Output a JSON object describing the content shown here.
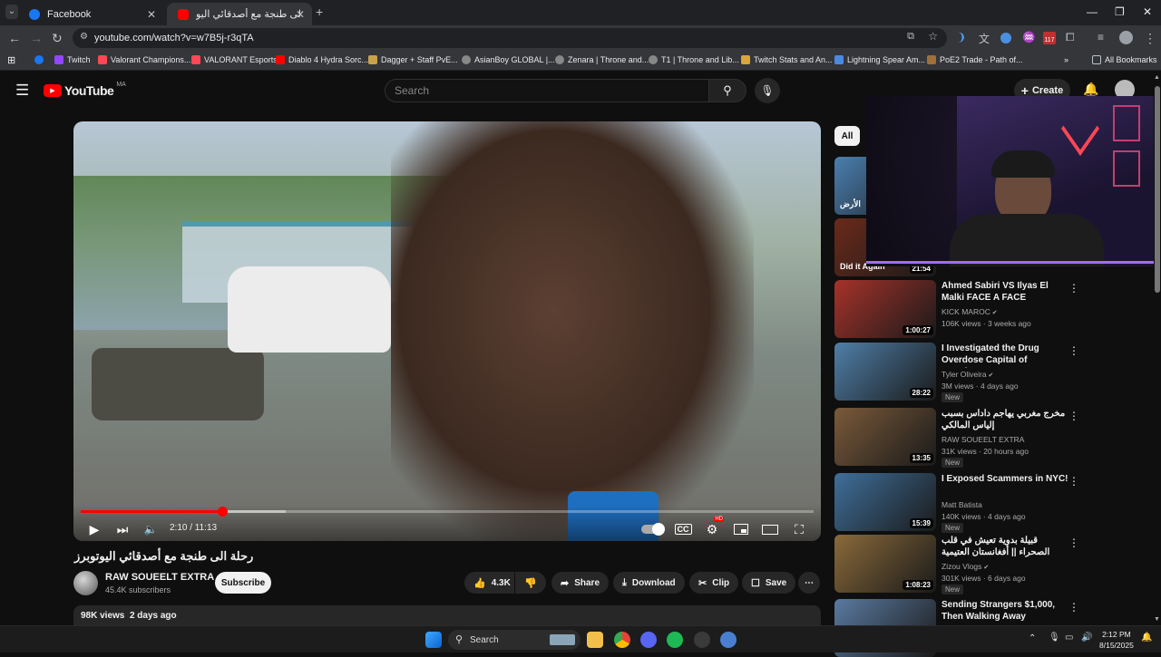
{
  "browser": {
    "tabs": [
      {
        "title": "Facebook",
        "active": false
      },
      {
        "title": "رحلة الى طنجة مع أصدقائي اليو",
        "active": true
      }
    ],
    "url": "youtube.com/watch?v=w7B5j-r3qTA",
    "bookmarks": [
      "Twitch",
      "Valorant Champions...",
      "VALORANT Esports",
      "Diablo 4 Hydra Sorc...",
      "Dagger + Staff PvE...",
      "AsianBoy GLOBAL |...",
      "Zenara | Throne and...",
      "T1 | Throne and Lib...",
      "Twitch Stats and An...",
      "Lightning Spear Am...",
      "PoE2 Trade - Path of..."
    ],
    "all_bookmarks": "All Bookmarks",
    "badge_count": "117"
  },
  "yt": {
    "logo": "YouTube",
    "country": "MA",
    "search_placeholder": "Search",
    "create_label": "Create"
  },
  "player": {
    "time": "2:10 / 11:13",
    "progress_fraction": 0.193,
    "buffer_fraction": 0.28,
    "hd_badge": "HD"
  },
  "video": {
    "title": "رحلة الى طنجة مع أصدقائي اليوتوبرز",
    "channel": "RAW SOUEELT EXTRA",
    "subscribers": "45.4K subscribers",
    "subscribe_label": "Subscribe",
    "likes": "4.3K",
    "share_label": "Share",
    "download_label": "Download",
    "clip_label": "Clip",
    "save_label": "Save",
    "views": "98K views",
    "age": "2 days ago"
  },
  "sidebar": {
    "chip_all": "All",
    "recommendations": [
      {
        "title": "",
        "channel": "",
        "meta": "",
        "duration": "",
        "new": false,
        "thumb_color": "#4a7fb0",
        "thumb_text": "الأرض"
      },
      {
        "title": "",
        "channel": "",
        "meta": "",
        "duration": "21:54",
        "new": false,
        "thumb_color": "#6a2a1a",
        "thumb_text": "Did it Again"
      },
      {
        "title": "Ahmed Sabiri VS Ilyas El Malki FACE A FACE",
        "channel": "KICK MAROC",
        "verified": true,
        "meta": "106K views · 3 weeks ago",
        "duration": "1:00:27",
        "new": false,
        "thumb_color": "#a6322a"
      },
      {
        "title": "I Investigated the Drug Overdose Capital of America...",
        "channel": "Tyler Oliveira",
        "verified": true,
        "meta": "3M views · 4 days ago",
        "duration": "28:22",
        "new": true,
        "thumb_color": "#4f7fa8"
      },
      {
        "title": "مخرج مغربي يهاجم داداس بسبب إلياس المالكي",
        "channel": "RAW SOUEELT EXTRA",
        "verified": false,
        "meta": "31K views · 20 hours ago",
        "duration": "13:35",
        "new": true,
        "thumb_color": "#7a5a3a"
      },
      {
        "title": "I Exposed Scammers in NYC!",
        "channel": "Matt Batista",
        "verified": false,
        "meta": "140K views · 4 days ago",
        "duration": "15:39",
        "new": true,
        "thumb_color": "#3f6f9a"
      },
      {
        "title": "قبيلة بدوية تعيش في قلب الصحراء || أفغانستان العتيمية",
        "channel": "Zizou Vlogs",
        "verified": true,
        "meta": "301K views · 6 days ago",
        "duration": "1:08:23",
        "new": true,
        "thumb_color": "#8a6a3a"
      },
      {
        "title": "Sending Strangers $1,000, Then Walking Away",
        "channel": "",
        "verified": false,
        "meta": "",
        "duration": "",
        "new": false,
        "thumb_color": "#5a7aa0"
      }
    ],
    "new_label": "New"
  },
  "taskbar": {
    "search_label": "Search",
    "time": "2:12 PM",
    "date": "8/15/2025"
  }
}
